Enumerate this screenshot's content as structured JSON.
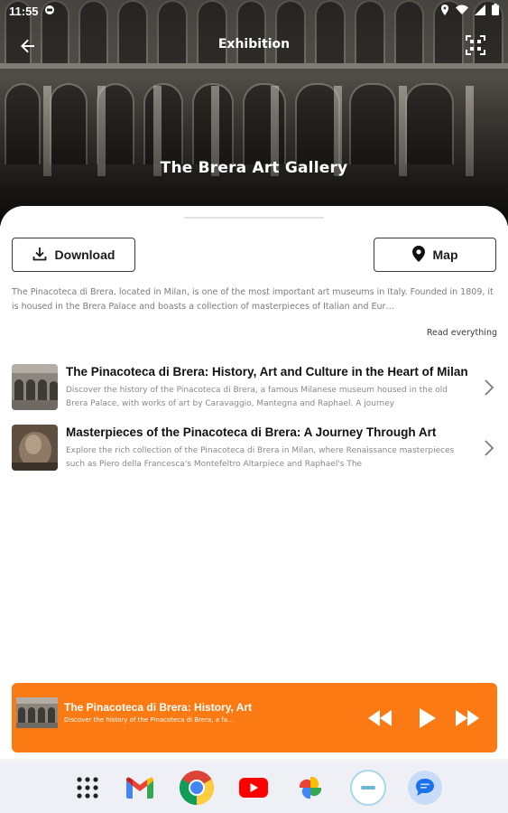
{
  "status_bar": {
    "time": "11:55",
    "icons": [
      "notification-icon",
      "location-icon",
      "wifi-icon",
      "signal-icon",
      "battery-icon"
    ]
  },
  "app_bar": {
    "title": "Exhibition",
    "back_icon": "arrow-back-icon",
    "qr_icon": "qr-scan-icon"
  },
  "hero": {
    "title": "The Brera Art Gallery"
  },
  "actions": {
    "download_label": "Download",
    "download_icon": "download-icon",
    "map_label": "Map",
    "map_icon": "map-pin-icon"
  },
  "description": {
    "text": "The Pinacoteca di Brera, located in Milan, is one of the most important art museums in Italy. Founded in 1809, it is housed in the Brera Palace and boasts a collection of masterpieces of Italian and Eur…",
    "read_more": "Read everything"
  },
  "tracks": [
    {
      "title": "The Pinacoteca di Brera: History, Art and Culture in the Heart of Milan",
      "description": "Discover the history of the Pinacoteca di Brera, a famous Milanese museum housed in the old Brera Palace, with works of art by Caravaggio, Mantegna and Raphael. A journey"
    },
    {
      "title": "Masterpieces of the Pinacoteca di Brera: A Journey Through Art",
      "description": "Explore the rich collection of the Pinacoteca di Brera in Milan, where Renaissance masterpieces such as Piero della Francesca's Montefeltro Altarpiece and Raphael's The"
    }
  ],
  "player": {
    "title": "The Pinacoteca di Brera: History, Art",
    "subtitle": "Discover the history of the Pinacoteca di Brera, a fa…",
    "accent": "#fb7a14"
  },
  "dock": {
    "apps": [
      "app-drawer-icon",
      "gmail-icon",
      "chrome-icon",
      "youtube-icon",
      "photos-icon",
      "other-app-icon",
      "messages-icon"
    ]
  }
}
